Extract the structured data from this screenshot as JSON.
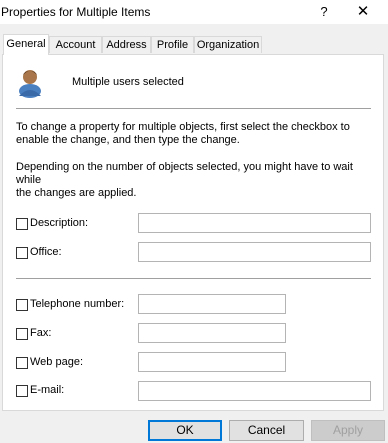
{
  "window": {
    "title": "Properties for Multiple Items",
    "help_glyph": "?",
    "close_glyph": "✕"
  },
  "tabs": [
    {
      "label": "General",
      "active": true
    },
    {
      "label": "Account",
      "active": false
    },
    {
      "label": "Address",
      "active": false
    },
    {
      "label": "Profile",
      "active": false
    },
    {
      "label": "Organization",
      "active": false
    }
  ],
  "general": {
    "icon": "user-avatar-icon",
    "summary": "Multiple users selected",
    "instructions_line1": "To change a property for multiple objects, first select the checkbox to",
    "instructions_line2": "enable the change, and then type the change.",
    "wait_line1": "Depending on the number of objects selected, you might have to wait while",
    "wait_line2": "the changes are applied."
  },
  "fields": {
    "description": {
      "label": "Description:",
      "checked": false,
      "value": ""
    },
    "office": {
      "label": "Office:",
      "checked": false,
      "value": ""
    },
    "telephone": {
      "label": "Telephone number:",
      "checked": false,
      "value": ""
    },
    "fax": {
      "label": "Fax:",
      "checked": false,
      "value": ""
    },
    "web_page": {
      "label": "Web page:",
      "checked": false,
      "value": ""
    },
    "email": {
      "label": "E-mail:",
      "checked": false,
      "value": ""
    }
  },
  "buttons": {
    "ok": "OK",
    "cancel": "Cancel",
    "apply": "Apply"
  },
  "colors": {
    "dialog_background": "#f0f0f0",
    "default_button_border": "#0078d7"
  }
}
